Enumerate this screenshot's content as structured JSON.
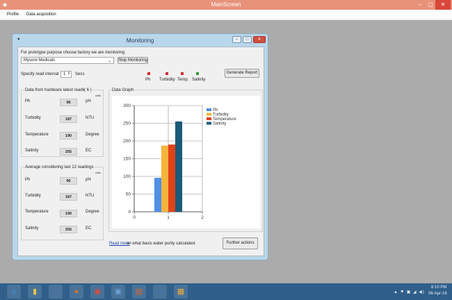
{
  "window": {
    "title": "MainScreen",
    "controls": {
      "minimize": "–",
      "maximize": "▢",
      "close": "✕"
    }
  },
  "menu": {
    "items": [
      "Profile",
      "Data acquisition"
    ]
  },
  "dialog": {
    "title": "Monitoring",
    "controls": {
      "minimize": "–",
      "maximize": "□",
      "close": "✕"
    },
    "factory_prompt": "For prototype purpose choose factory we are monitoring",
    "factory_selected": "Mysore Medicals",
    "stop_button": "Stop Monitoring",
    "interval_label": "Specify read interval",
    "interval_value": "1",
    "interval_unit": "Secs",
    "generate_button": "Generate Report",
    "indicators": [
      {
        "label": "Ph",
        "color": "#d42a2a"
      },
      {
        "label": "Turbidity",
        "color": "#d42a2a"
      },
      {
        "label": "Temp.",
        "color": "#d42a2a"
      },
      {
        "label": "Salinity",
        "color": "#2f9a3a"
      }
    ],
    "latest": {
      "title": "Data from hardware latest reading",
      "count": "( 6 )",
      "units_header": "Units",
      "rows": [
        {
          "label": "Ph",
          "value": "96",
          "unit": "pH"
        },
        {
          "label": "Turbidity",
          "value": "187",
          "unit": "NTU"
        },
        {
          "label": "Temperature",
          "value": "190",
          "unit": "Degree"
        },
        {
          "label": "Salinity",
          "value": "255",
          "unit": "EC"
        }
      ]
    },
    "average": {
      "title": "Average considering last 12 readings",
      "units_header": "Units",
      "rows": [
        {
          "label": "Ph",
          "value": "96",
          "unit": "pH"
        },
        {
          "label": "Turbidity",
          "value": "187",
          "unit": "NTU"
        },
        {
          "label": "Temperature",
          "value": "190",
          "unit": "Degree"
        },
        {
          "label": "Salinity",
          "value": "255",
          "unit": "EC"
        }
      ]
    },
    "graph_title": "Data Graph",
    "read_more_link": "Read more",
    "read_more_text": "on what basis water purity calculated.",
    "further_button": "Further actions"
  },
  "chart_data": {
    "type": "bar",
    "series": [
      {
        "name": "Ph",
        "values": [
          96
        ],
        "color": "#4f8fe6"
      },
      {
        "name": "Turbidity",
        "values": [
          187
        ],
        "color": "#f5b43c"
      },
      {
        "name": "Temperature",
        "values": [
          190
        ],
        "color": "#e0421a"
      },
      {
        "name": "Salinity",
        "values": [
          255
        ],
        "color": "#1a5a7a"
      }
    ],
    "x_center": 1,
    "xlim": [
      0,
      2
    ],
    "ylim": [
      0,
      300
    ],
    "xticks": [
      "0",
      "1",
      "2"
    ],
    "yticks": [
      "0",
      "50",
      "100",
      "150",
      "200",
      "250",
      "300"
    ],
    "grid": true,
    "legend_position": "top-right"
  },
  "taskbar": {
    "icons": [
      {
        "name": "ie",
        "glyph": "e",
        "color": "#3b8fe0"
      },
      {
        "name": "folder",
        "glyph": "▮",
        "color": "#e8c24a"
      },
      {
        "name": "mail",
        "glyph": "M",
        "color": "#5f6fb0"
      },
      {
        "name": "firefox",
        "glyph": "●",
        "color": "#e56b1f"
      },
      {
        "name": "chrome",
        "glyph": "◉",
        "color": "#e84a3a"
      },
      {
        "name": "app",
        "glyph": "▣",
        "color": "#6a9ed6"
      },
      {
        "name": "office",
        "glyph": "▤",
        "color": "#e0632c"
      },
      {
        "name": "media",
        "glyph": "∞",
        "color": "#3a78c8"
      },
      {
        "name": "tiles",
        "glyph": "▦",
        "color": "#f0a93a"
      }
    ],
    "tray_icons": "▲ ⚑ ▣ ◢ ◀)",
    "time": "8:10 PM",
    "date": "06-Apr-16"
  }
}
